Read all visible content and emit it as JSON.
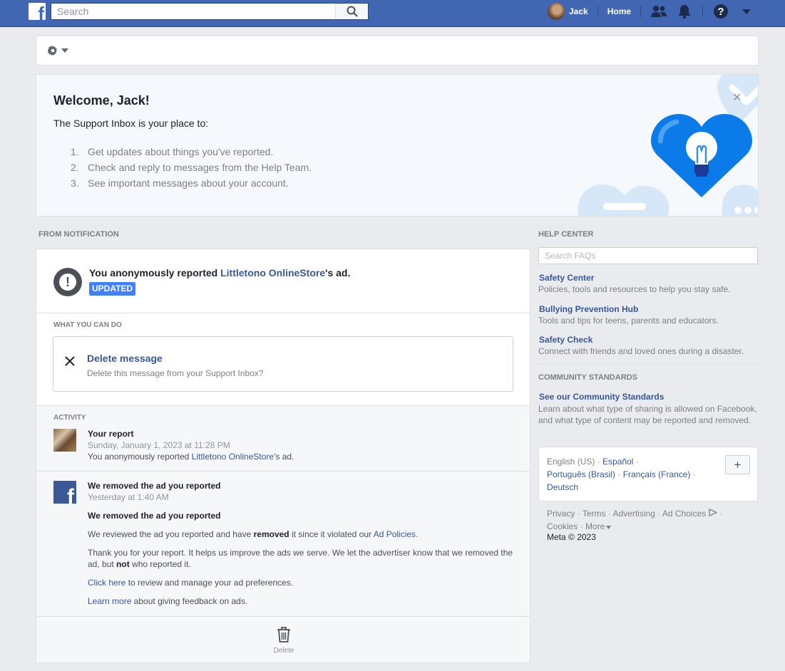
{
  "topbar": {
    "logo": "f",
    "search_placeholder": "Search",
    "user_name": "Jack",
    "home": "Home",
    "icons": [
      "search-icon",
      "friends-icon",
      "notifications-bell-icon",
      "help-icon",
      "caret-down-icon"
    ],
    "brand_color": "#4267b2"
  },
  "welcome": {
    "title": "Welcome, Jack!",
    "intro": "The Support Inbox is your place to:",
    "items": [
      {
        "num": "1.",
        "text": "Get updates about things you've reported."
      },
      {
        "num": "2.",
        "text": "Check and reply to messages from the Help Team."
      },
      {
        "num": "3.",
        "text": "See important messages about your account."
      }
    ],
    "close": "✕"
  },
  "from_notification": {
    "label": "FROM NOTIFICATION",
    "report_prefix": "You anonymously reported ",
    "report_link": "Littletono OnlineStore",
    "report_suffix": "'s ad.",
    "badge": "UPDATED",
    "what_label": "WHAT YOU CAN DO",
    "delete_title": "Delete message",
    "delete_sub": "Delete this message from your Support Inbox?",
    "activity_label": "ACTIVITY",
    "activity": [
      {
        "title": "Your report",
        "time": "Sunday, January 1, 2023 at 11:28 PM",
        "text_prefix": "You anonymously reported ",
        "text_link": "Littletono OnlineStore",
        "text_suffix": "'s ad."
      },
      {
        "title": "We removed the ad you reported",
        "time": "Yesterday at 1:40 AM",
        "heading": "We removed the ad you reported",
        "p1_a": "We reviewed the ad you reported and have ",
        "p1_b": "removed",
        "p1_c": " it since it violated our ",
        "p1_link": "Ad Policies",
        "p1_d": ".",
        "p2_a": "Thank you for your report. It helps us improve the ads we serve. We let the advertiser know that we removed the ad, but ",
        "p2_b": "not",
        "p2_c": " who reported it.",
        "p3_link": "Click here",
        "p3_text": " to review and manage your ad preferences.",
        "p4_link": "Learn more",
        "p4_text": " about giving feedback on ads."
      }
    ],
    "delete_label": "Delete"
  },
  "help_center": {
    "label": "HELP CENTER",
    "search_placeholder": "Search FAQs",
    "links": [
      {
        "title": "Safety Center",
        "desc": "Policies, tools and resources to help you stay safe."
      },
      {
        "title": "Bullying Prevention Hub",
        "desc": "Tools and tips for teens, parents and educators."
      },
      {
        "title": "Safety Check",
        "desc": "Connect with friends and loved ones during a disaster."
      }
    ],
    "community_label": "COMMUNITY STANDARDS",
    "community_link": "See our Community Standards",
    "community_desc": "Learn about what type of sharing is allowed on Facebook, and what type of content may be reported and removed."
  },
  "languages": {
    "current": "English (US)",
    "others": [
      "Español",
      "Português (Brasil)",
      "Français (France)",
      "Deutsch"
    ],
    "add": "+"
  },
  "footer": {
    "links": [
      "Privacy",
      "Terms",
      "Advertising",
      "Ad Choices",
      "Cookies",
      "More"
    ],
    "copyright": "Meta © 2023"
  }
}
